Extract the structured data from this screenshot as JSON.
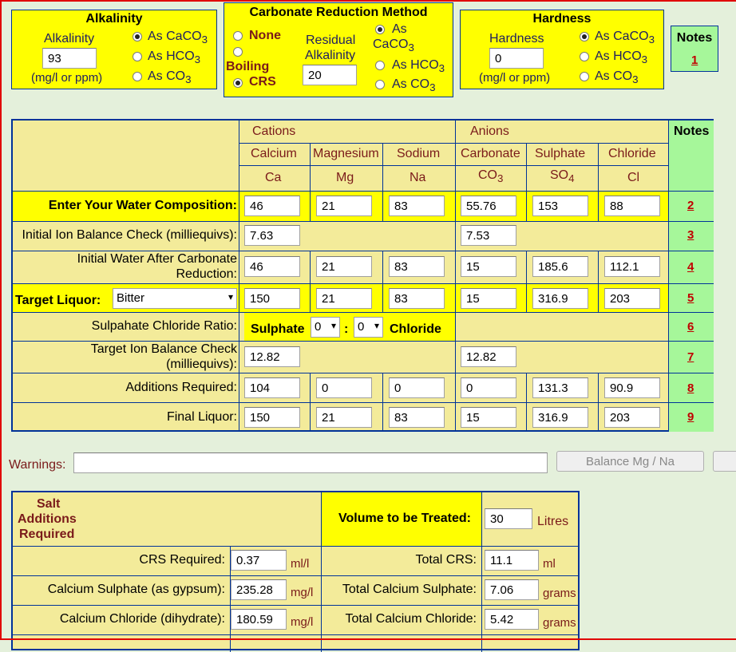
{
  "alkalinity": {
    "title": "Alkalinity",
    "label": "Alkalinity",
    "value": "93",
    "unit": "(mg/l or ppm)",
    "options": [
      "As CaCO3",
      "As HCO3",
      "As CO3"
    ],
    "selected": "As CaCO3"
  },
  "carbonate": {
    "title": "Carbonate Reduction Method",
    "opt_none": "None",
    "opt_boiling": "Boiling",
    "opt_crs": "CRS",
    "selected": "CRS",
    "residual_label_1": "Residual",
    "residual_label_2": "Alkalinity",
    "residual_value": "20",
    "opt_caco3_a": "As",
    "opt_caco3_b": "CaCO3",
    "opt_hco3": "As HCO3",
    "opt_co3": "As CO3"
  },
  "hardness": {
    "title": "Hardness",
    "label": "Hardness",
    "value": "0",
    "unit": "(mg/l or ppm)",
    "options": [
      "As CaCO3",
      "As HCO3",
      "As CO3"
    ],
    "selected": "As CaCO3"
  },
  "notes_box": {
    "title": "Notes",
    "link": "1"
  },
  "table": {
    "cations": "Cations",
    "anions": "Anions",
    "notes": "Notes",
    "columns": [
      {
        "name": "Calcium",
        "symbol": "Ca"
      },
      {
        "name": "Magnesium",
        "symbol": "Mg"
      },
      {
        "name": "Sodium",
        "symbol": "Na"
      },
      {
        "name": "Carbonate",
        "symbol": "CO3"
      },
      {
        "name": "Sulphate",
        "symbol": "SO4"
      },
      {
        "name": "Chloride",
        "symbol": "Cl"
      }
    ],
    "rows": [
      {
        "label": "Enter Your Water Composition:",
        "values": [
          "46",
          "21",
          "83",
          "55.76",
          "153",
          "88"
        ],
        "note": "2"
      },
      {
        "label": "Initial Ion Balance Check (milliequivs):",
        "cation_total": "7.63",
        "anion_total": "7.53",
        "note": "3"
      },
      {
        "label": "Initial Water After Carbonate Reduction:",
        "values": [
          "46",
          "21",
          "83",
          "15",
          "185.6",
          "112.1"
        ],
        "note": "4"
      },
      {
        "label": "Target Liquor:",
        "select": "Bitter",
        "values": [
          "150",
          "21",
          "83",
          "15",
          "316.9",
          "203"
        ],
        "note": "5"
      },
      {
        "label": "Sulpahate Chloride Ratio:",
        "sulphate": "Sulphate",
        "ratio_a": "0",
        "sep": ":",
        "ratio_b": "0",
        "chloride": "Chloride",
        "note": "6"
      },
      {
        "label": "Target Ion Balance Check (milliequivs):",
        "cation_total": "12.82",
        "anion_total": "12.82",
        "note": "7"
      },
      {
        "label": "Additions Required:",
        "values": [
          "104",
          "0",
          "0",
          "0",
          "131.3",
          "90.9"
        ],
        "note": "8"
      },
      {
        "label": "Final Liquor:",
        "values": [
          "150",
          "21",
          "83",
          "15",
          "316.9",
          "203"
        ],
        "note": "9"
      }
    ]
  },
  "warnings": {
    "label": "Warnings:",
    "value": "",
    "button": "Balance Mg / Na"
  },
  "salt": {
    "title_1": "Salt",
    "title_2": "Additions",
    "title_3": "Required",
    "volume_label": "Volume to be Treated:",
    "volume_value": "30",
    "volume_unit": "Litres",
    "rows": [
      {
        "label": "CRS Required:",
        "value": "0.37",
        "unit": "ml/l",
        "total_label": "Total CRS:",
        "total": "11.1",
        "total_unit": "ml"
      },
      {
        "label": "Calcium Sulphate (as gypsum):",
        "value": "235.28",
        "unit": "mg/l",
        "total_label": "Total Calcium Sulphate:",
        "total": "7.06",
        "total_unit": "grams"
      },
      {
        "label": "Calcium Chloride (dihydrate):",
        "value": "180.59",
        "unit": "mg/l",
        "total_label": "Total Calcium Chloride:",
        "total": "5.42",
        "total_unit": "grams"
      }
    ]
  }
}
